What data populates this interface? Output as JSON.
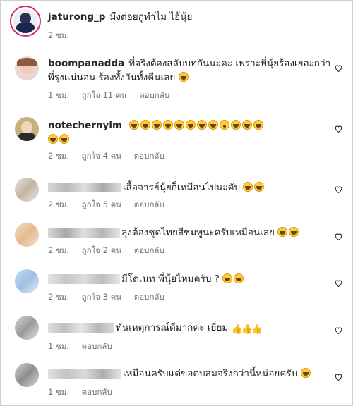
{
  "comments": [
    {
      "username": "jaturong_p",
      "text": "มึงต่อยกูทำไม ไอ้นุ้ย",
      "time": "2 ชม.",
      "likes": "",
      "reply": "",
      "emoji": []
    },
    {
      "username": "boompanadda",
      "text": "ที่จริงต้องสลับบทกันนะคะ เพราะพี่นุ้ยร้องเยอะกว่า",
      "text2": "พี่รุงแน่นอน ร้องทั้งวันทั้งคืนเลย",
      "time": "1 ชม.",
      "likes": "ถูกใจ 11 คน",
      "reply": "ตอบกลับ"
    },
    {
      "username": "notechernyim",
      "text": "",
      "time": "2 ชม.",
      "likes": "ถูกใจ 4 คน",
      "reply": "ตอบกลับ"
    },
    {
      "username": "",
      "text": "เสื้อจารย์นุ้ยก็เหมือนไปนะคับ",
      "time": "2 ชม.",
      "likes": "ถูกใจ 5 คน",
      "reply": "ตอบกลับ"
    },
    {
      "username": "",
      "text": "ลุงต้องชุดไทยสีชมพูนะครับเหมือนเลย",
      "time": "2 ชม.",
      "likes": "ถูกใจ 2 คน",
      "reply": "ตอบกลับ"
    },
    {
      "username": "",
      "text": "มีโดเนท พี่นุ้ยไหมครับ ?",
      "time": "2 ชม.",
      "likes": "ถูกใจ 3 คน",
      "reply": "ตอบกลับ"
    },
    {
      "username": "",
      "text": "ทันเหตุการณ์ดีมากค่ะ เยี่ยม",
      "time": "1 ชม.",
      "likes": "",
      "reply": "ตอบกลับ"
    },
    {
      "username": "",
      "text": "เหมือนครับแต่ขอตบสมจริงกว่านี้หน่อยครับ",
      "time": "1 ชม.",
      "likes": "",
      "reply": "ตอบกลับ"
    }
  ],
  "colors": {
    "text": "#262626",
    "meta": "#737373",
    "story_ring": "#d62976",
    "heart": "#262626"
  },
  "icons": {
    "heart": "heart-outline-icon",
    "emoji_laugh": "grinning-squinting-face",
    "emoji_wow": "face-with-open-mouth",
    "thumbs": "thumbs-up"
  }
}
